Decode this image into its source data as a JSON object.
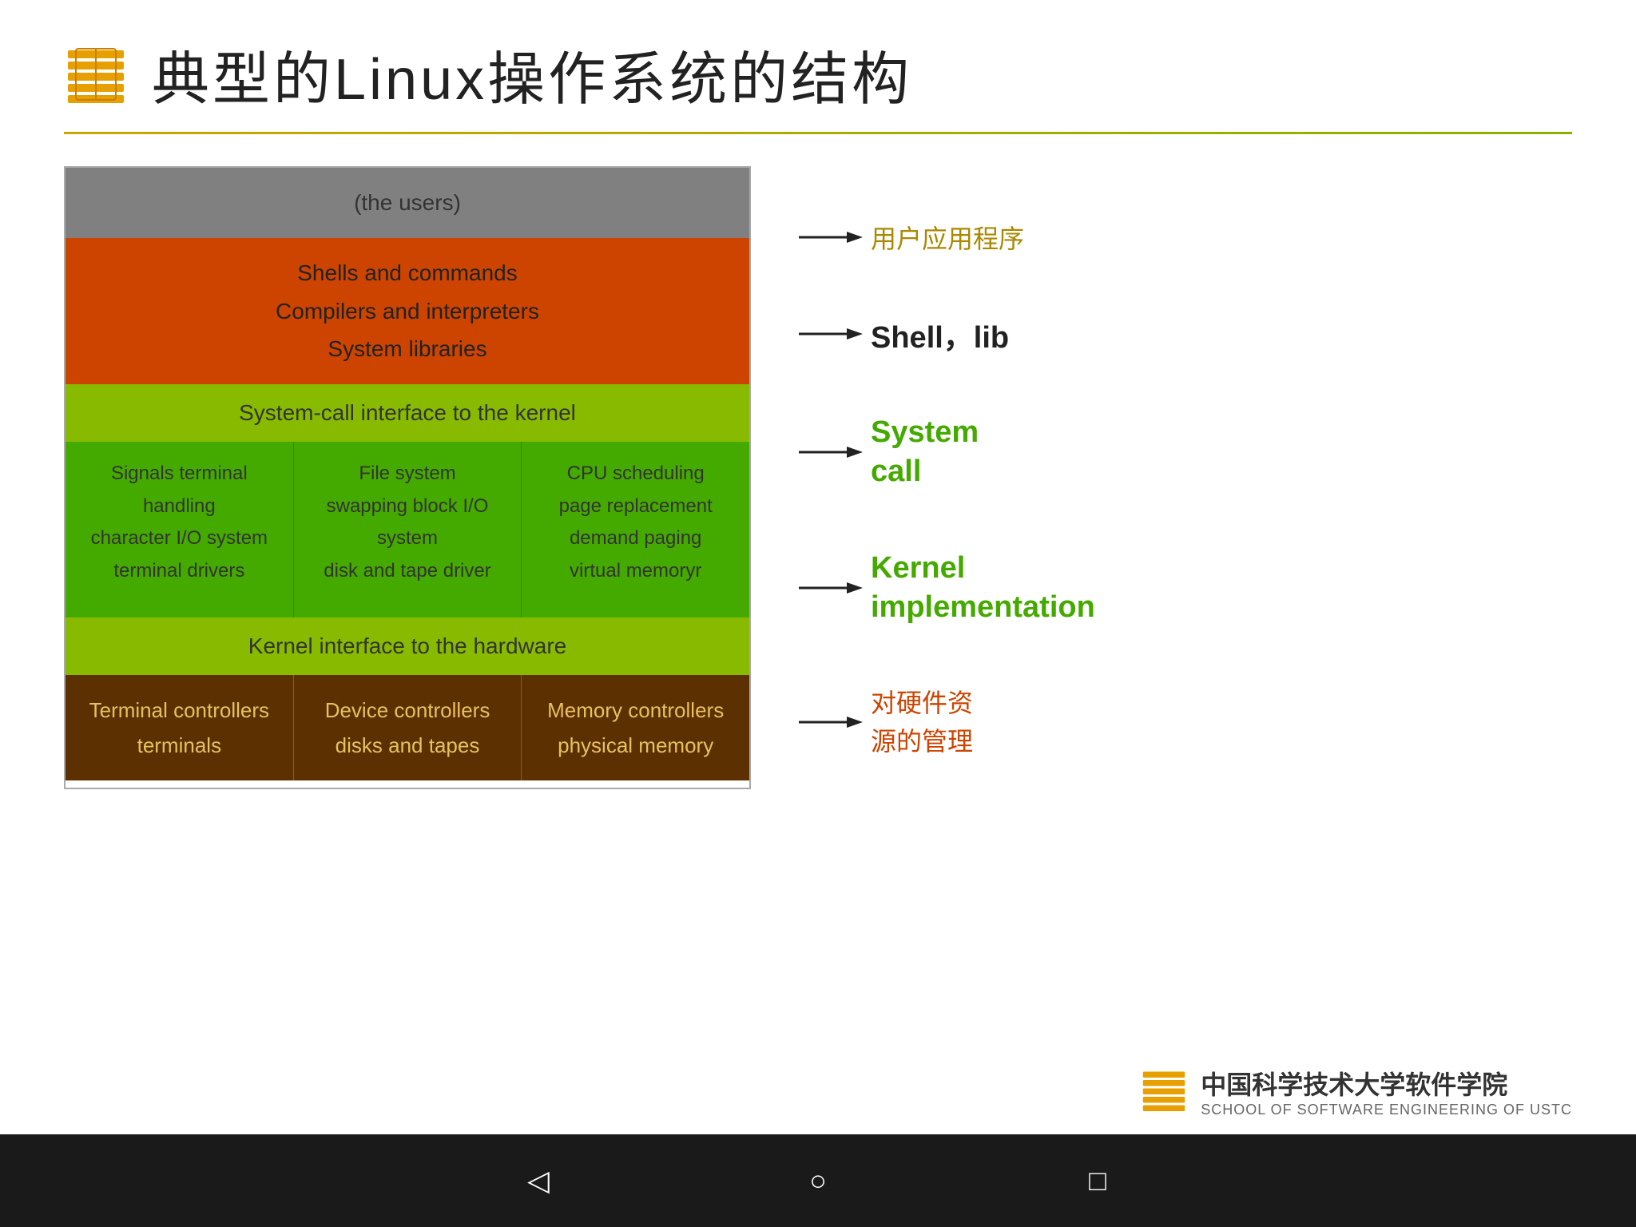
{
  "title": "典型的Linux操作系统的结构",
  "diagram": {
    "layer_users": "(the users)",
    "layer_orange_lines": [
      "Shells and commands",
      "Compilers and interpreters",
      "System libraries"
    ],
    "layer_syscall": "System-call interface to the kernel",
    "kernel_col1": [
      "Signals terminal",
      "handling",
      "character I/O system",
      "terminal    drivers"
    ],
    "kernel_col2": [
      "File system",
      "swapping block I/O",
      "system",
      "disk and tape driver"
    ],
    "kernel_col3": [
      "CPU scheduling",
      "page replacement",
      "demand paging",
      "virtual memoryr"
    ],
    "layer_hw_interface": "Kernel interface to the hardware",
    "ctrl_col1_lines": [
      "Terminal controllers",
      "terminals"
    ],
    "ctrl_col2_lines": [
      "Device controllers",
      "disks and tapes"
    ],
    "ctrl_col3_lines": [
      "Memory controllers",
      "physical memory"
    ]
  },
  "annotations": {
    "users_label": "用户应用程序",
    "shell_label": "Shell，lib",
    "syscall_line1": "System",
    "syscall_line2": "call",
    "kernel_line1": "Kernel",
    "kernel_line2": "implementation",
    "hw_line1": "对硬件资",
    "hw_line2": "源的管理"
  },
  "footer": {
    "school_name": "中国科学技术大学软件学院",
    "school_sub": "SCHOOL OF SOFTWARE ENGINEERING OF USTC"
  },
  "nav": {
    "back": "◁",
    "home": "○",
    "square": "□"
  }
}
